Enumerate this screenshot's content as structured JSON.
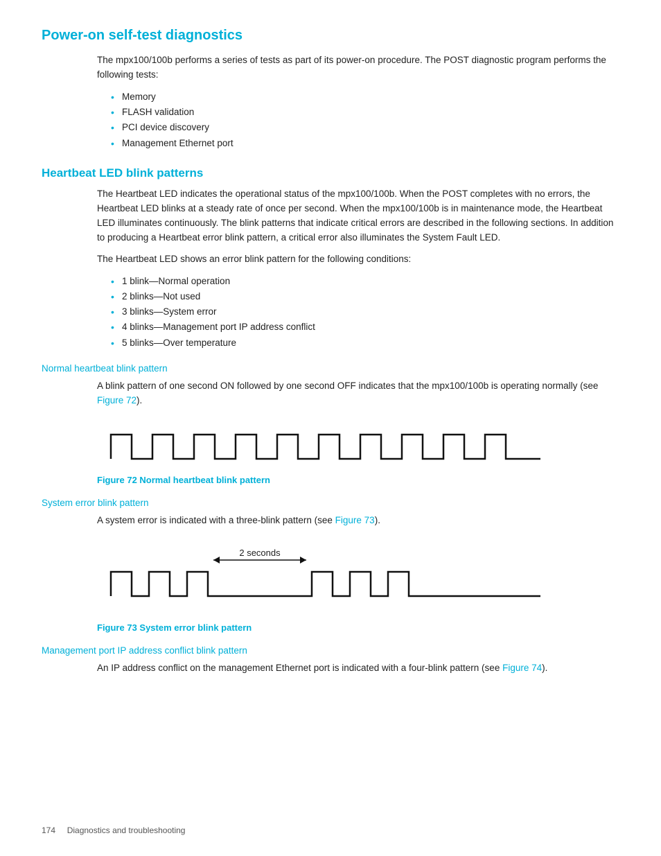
{
  "page": {
    "title": "Power-on self-test diagnostics",
    "sections": {
      "post": {
        "heading": "Power-on self-test diagnostics",
        "body": "The mpx100/100b performs a series of tests as part of its power-on procedure. The POST diagnostic program performs the following tests:",
        "bullets": [
          "Memory",
          "FLASH validation",
          "PCI device discovery",
          "Management Ethernet port"
        ]
      },
      "heartbeat": {
        "heading": "Heartbeat LED blink patterns",
        "body1": "The Heartbeat LED indicates the operational status of the mpx100/100b. When the POST completes with no errors, the Heartbeat LED blinks at a steady rate of once per second. When the mpx100/100b is in maintenance mode, the Heartbeat LED illuminates continuously. The blink patterns that indicate critical errors are described in the following sections. In addition to producing a Heartbeat error blink pattern, a critical error also illuminates the System Fault LED.",
        "body2": "The Heartbeat LED shows an error blink pattern for the following conditions:",
        "bullets": [
          "1 blink—Normal operation",
          "2 blinks—Not used",
          "3 blinks—System error",
          "4 blinks—Management port IP address conflict",
          "5 blinks—Over temperature"
        ]
      },
      "normal_blink": {
        "heading": "Normal heartbeat blink pattern",
        "body": "A blink pattern of one second ON followed by one second OFF indicates that the mpx100/100b is operating normally (see Figure 72).",
        "figure_caption": "Figure 72 Normal heartbeat blink pattern"
      },
      "system_error": {
        "heading": "System error blink pattern",
        "body": "A system error is indicated with a three-blink pattern (see Figure 73).",
        "figure_caption": "Figure 73 System error blink pattern",
        "seconds_label": "2 seconds"
      },
      "mgmt_port": {
        "heading": "Management port IP address conflict blink pattern",
        "body1": "An IP address conflict on the management Ethernet port is indicated with a four-blink pattern (see",
        "body2": "Figure 74",
        "body3": ")."
      }
    },
    "footer": {
      "page_number": "174",
      "section": "Diagnostics and troubleshooting"
    },
    "links": {
      "figure72": "Figure 72",
      "figure73": "Figure 73",
      "figure74": "Figure 74"
    }
  }
}
